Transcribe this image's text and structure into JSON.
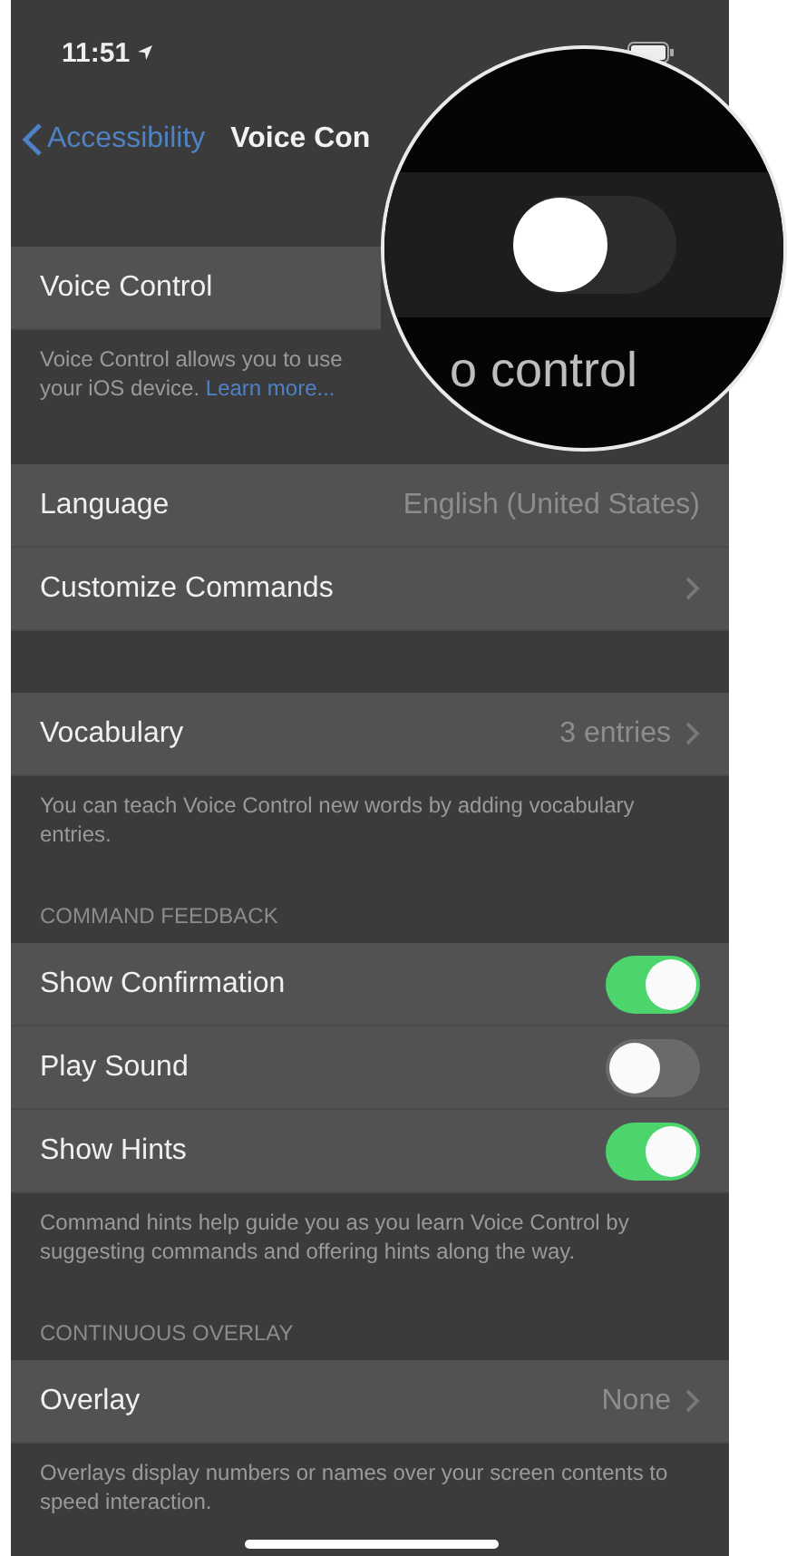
{
  "status_bar": {
    "time": "11:51"
  },
  "nav": {
    "back": "Accessibility",
    "title": "Voice Con"
  },
  "sections": [
    {
      "rows": [
        {
          "kind": "toggle_hidden",
          "label": "Voice Control"
        }
      ],
      "footer": {
        "lines": [
          "Voice Control allows you to use",
          "your iOS device."
        ],
        "link": "Learn more..."
      }
    },
    {
      "rows": [
        {
          "kind": "value",
          "label": "Language",
          "value": "English (United States)",
          "chevron": false
        },
        {
          "kind": "value",
          "label": "Customize Commands",
          "chevron": true
        }
      ]
    },
    {
      "rows": [
        {
          "kind": "value",
          "label": "Vocabulary",
          "value": "3 entries",
          "chevron": true
        }
      ],
      "footer": {
        "lines": [
          "You can teach Voice Control new words by adding vocabulary entries."
        ]
      }
    },
    {
      "header": "COMMAND FEEDBACK",
      "rows": [
        {
          "kind": "toggle",
          "label": "Show Confirmation",
          "on": true
        },
        {
          "kind": "toggle",
          "label": "Play Sound",
          "on": false
        },
        {
          "kind": "toggle",
          "label": "Show Hints",
          "on": true
        }
      ],
      "footer": {
        "lines": [
          "Command hints help guide you as you learn Voice Control by suggesting commands and offering hints along the way."
        ]
      }
    },
    {
      "header": "CONTINUOUS OVERLAY",
      "rows": [
        {
          "kind": "value",
          "label": "Overlay",
          "value": "None",
          "chevron": true
        }
      ],
      "footer": {
        "lines": [
          "Overlays display numbers or names over your screen contents to speed interaction."
        ]
      }
    }
  ],
  "magnifier": {
    "text": "o control",
    "on": false
  }
}
